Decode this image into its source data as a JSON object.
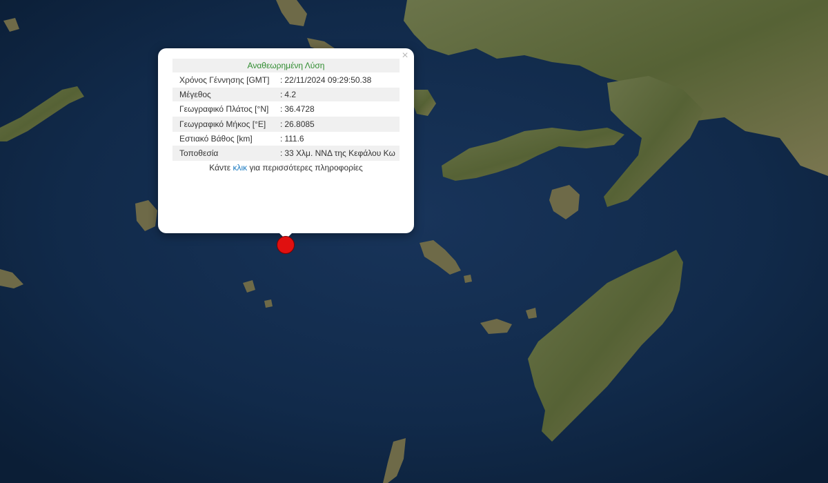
{
  "popup": {
    "title": "Αναθεωρημένη Λύση",
    "close_glyph": "×",
    "rows": [
      {
        "label": "Χρόνος Γέννησης [GMT]",
        "value": "22/11/2024 09:29:50.38"
      },
      {
        "label": "Μέγεθος",
        "value": "4.2"
      },
      {
        "label": "Γεωγραφικό Πλάτος [°N]",
        "value": "36.4728"
      },
      {
        "label": "Γεωγραφικό Μήκος [°E]",
        "value": "26.8085"
      },
      {
        "label": "Εστιακό Βάθος [km]",
        "value": "111.6"
      },
      {
        "label": "Τοποθεσία",
        "value": "33 Χλμ. ΝΝΔ της Κεφάλου Κω"
      }
    ],
    "colon": ":",
    "more_prefix": "Κάντε",
    "more_link": "κλικ",
    "more_suffix": "για περισσότερες πληροφορίες"
  },
  "colors": {
    "sea": "#0f2440",
    "land": "#5f6a3c",
    "title_green": "#2e8b2e",
    "link_blue": "#1a7ac0",
    "marker_red": "#e01010"
  },
  "icons": {
    "close": "close-icon",
    "marker": "epicenter-marker-icon"
  }
}
